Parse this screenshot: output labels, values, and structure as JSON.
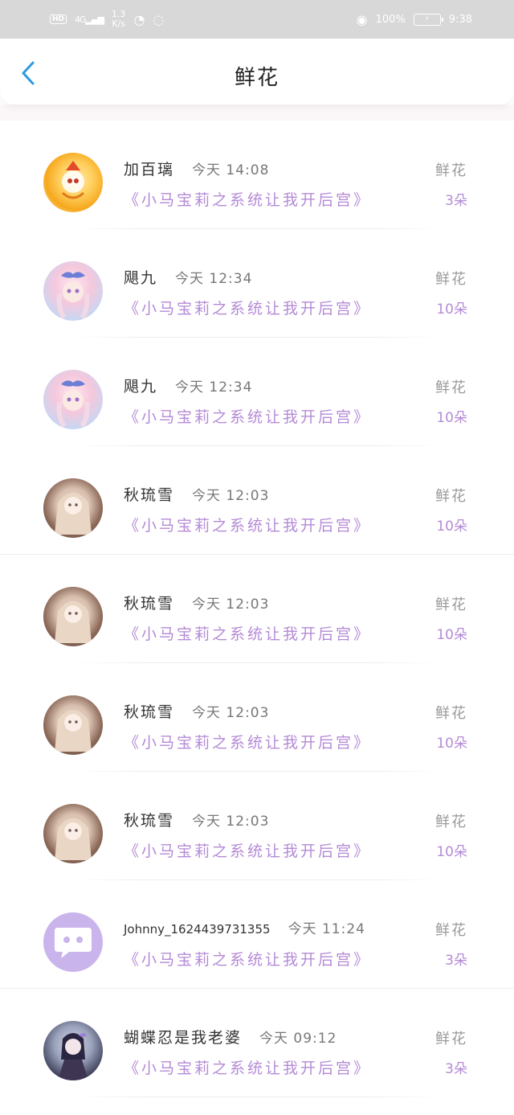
{
  "status_bar": {
    "hd": "HD",
    "network": "4G",
    "signal": "▂▄▆",
    "speed_value": "1.3",
    "speed_unit": "K/s",
    "battery": "100%",
    "time": "9:38"
  },
  "header": {
    "title": "鲜花"
  },
  "accent_color": "#b48ad6",
  "rows": [
    {
      "name": "加百璃",
      "time": "今天 14:08",
      "book": "《小马宝莉之系统让我开后宫》",
      "gift_type": "鲜花",
      "gift_count": "3朵",
      "avatar": "orange-avatar"
    },
    {
      "name": "飓九",
      "time": "今天 12:34",
      "book": "《小马宝莉之系统让我开后宫》",
      "gift_type": "鲜花",
      "gift_count": "10朵",
      "avatar": "pink-avatar"
    },
    {
      "name": "飓九",
      "time": "今天 12:34",
      "book": "《小马宝莉之系统让我开后宫》",
      "gift_type": "鲜花",
      "gift_count": "10朵",
      "avatar": "pink-avatar"
    },
    {
      "name": "秋琉雪",
      "time": "今天 12:03",
      "book": "《小马宝莉之系统让我开后宫》",
      "gift_type": "鲜花",
      "gift_count": "10朵",
      "avatar": "dark-avatar"
    },
    {
      "name": "秋琉雪",
      "time": "今天 12:03",
      "book": "《小马宝莉之系统让我开后宫》",
      "gift_type": "鲜花",
      "gift_count": "10朵",
      "avatar": "dark-avatar"
    },
    {
      "name": "秋琉雪",
      "time": "今天 12:03",
      "book": "《小马宝莉之系统让我开后宫》",
      "gift_type": "鲜花",
      "gift_count": "10朵",
      "avatar": "dark-avatar"
    },
    {
      "name": "秋琉雪",
      "time": "今天 12:03",
      "book": "《小马宝莉之系统让我开后宫》",
      "gift_type": "鲜花",
      "gift_count": "10朵",
      "avatar": "dark-avatar"
    },
    {
      "name": "Johnny_1624439731355",
      "time": "今天 11:24",
      "book": "《小马宝莉之系统让我开后宫》",
      "gift_type": "鲜花",
      "gift_count": "3朵",
      "avatar": "default-avatar"
    },
    {
      "name": "蝴蝶忍是我老婆",
      "time": "今天 09:12",
      "book": "《小马宝莉之系统让我开后宫》",
      "gift_type": "鲜花",
      "gift_count": "3朵",
      "avatar": "night-avatar"
    }
  ]
}
